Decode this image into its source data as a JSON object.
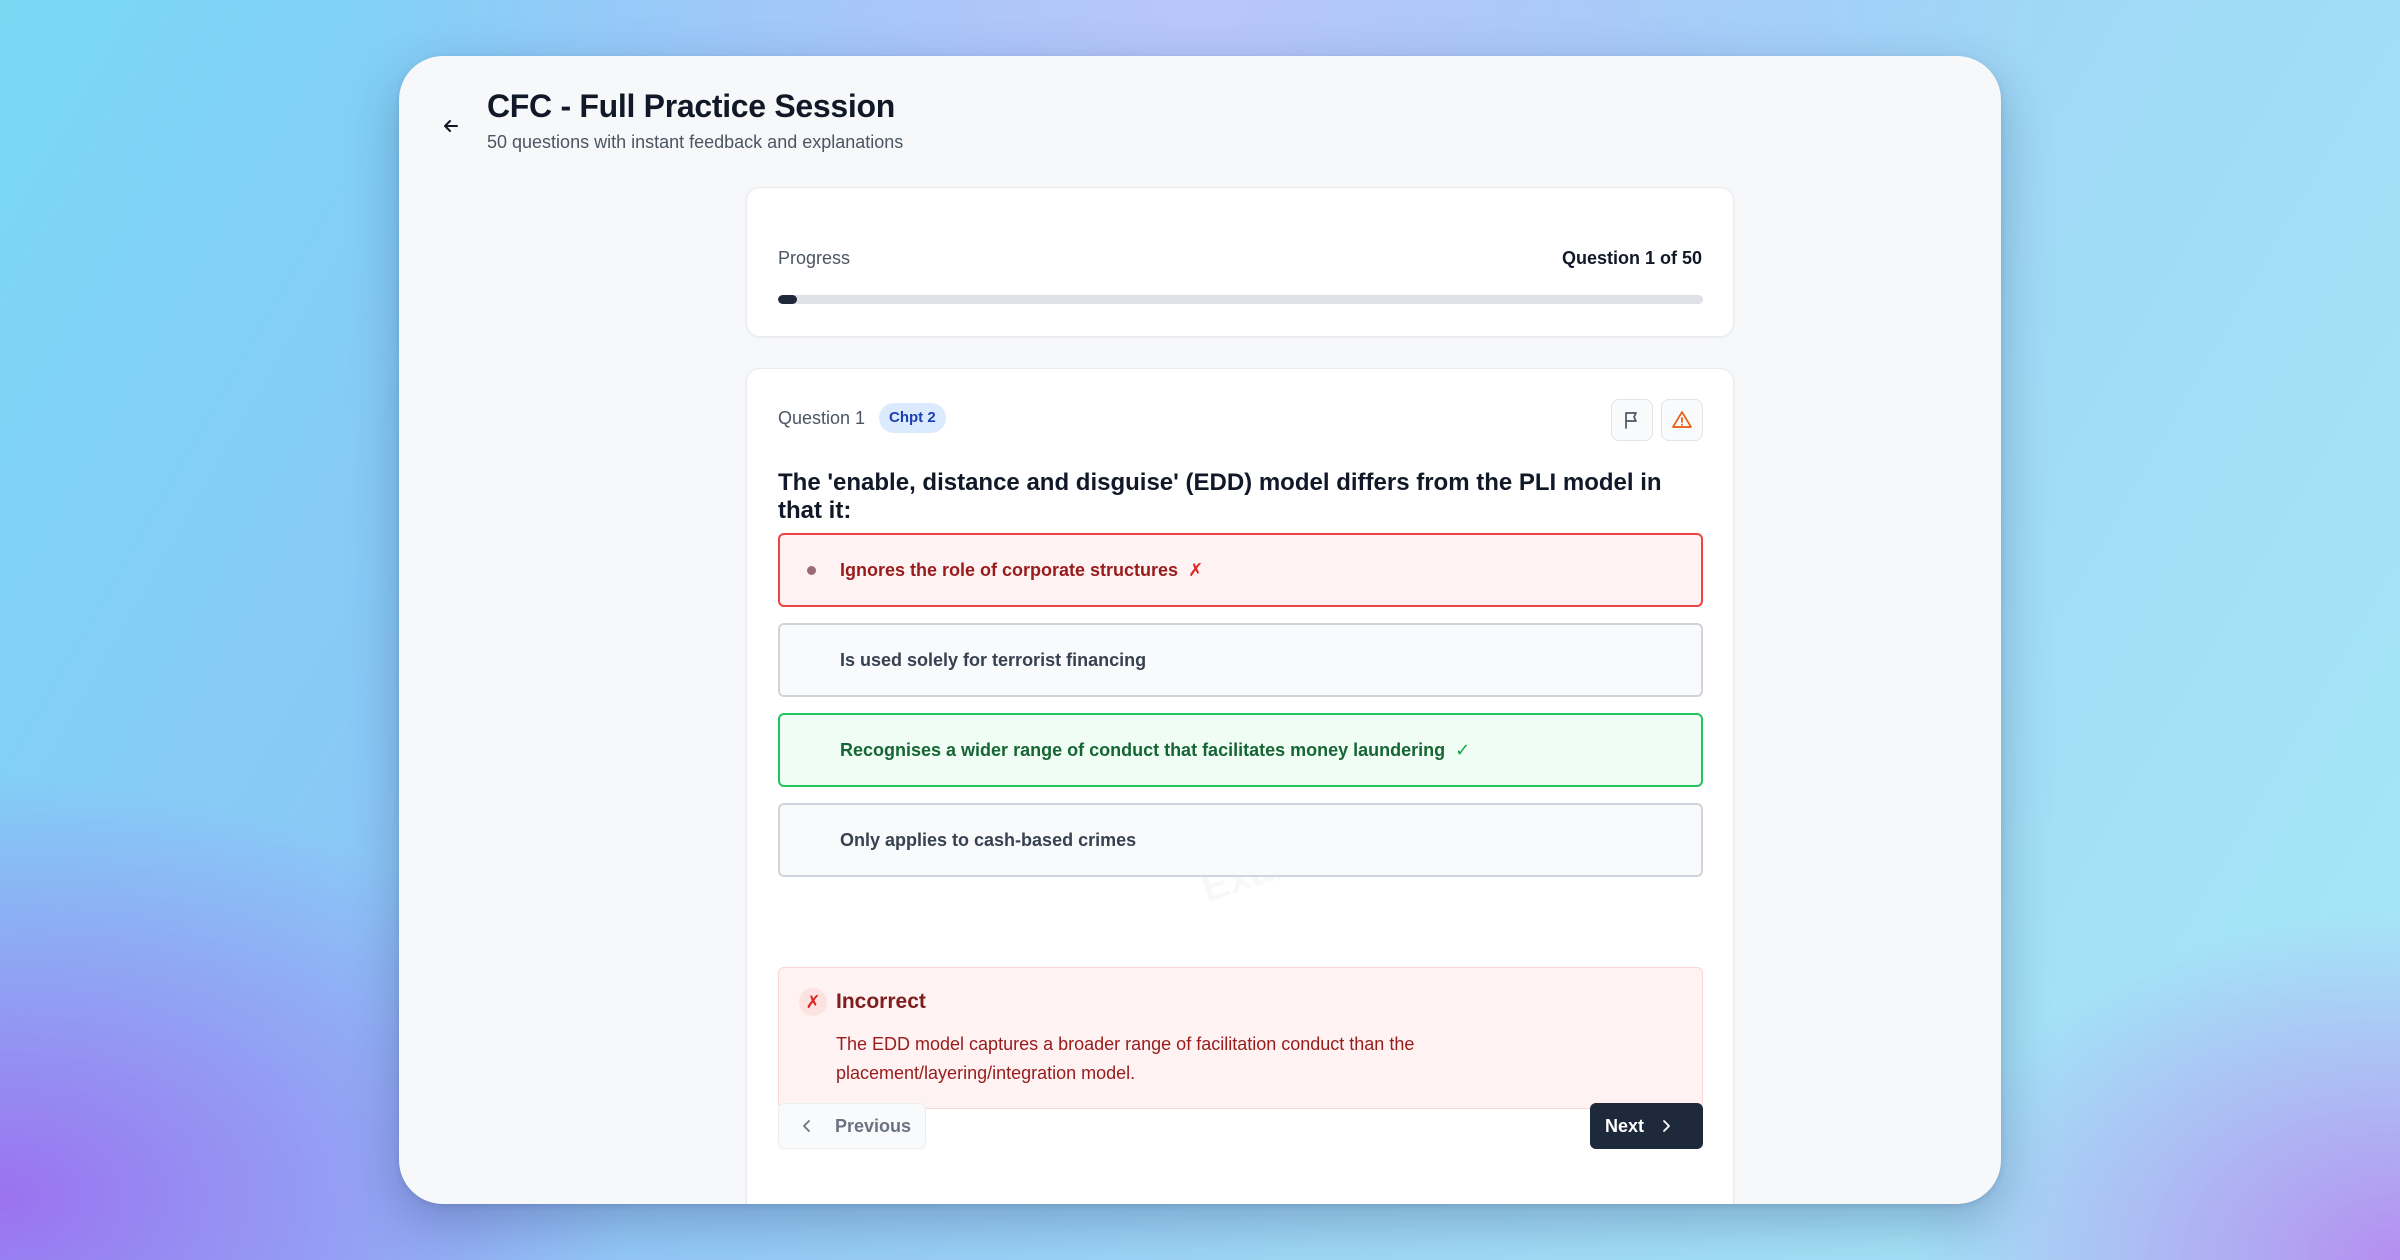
{
  "header": {
    "title": "CFC - Full Practice Session",
    "subtitle": "50 questions with instant feedback and explanations",
    "back_icon": "arrow-left-icon"
  },
  "progress": {
    "label": "Progress",
    "count_text": "Question 1 of 50",
    "current": 1,
    "total": 50
  },
  "question": {
    "number_label": "Question 1",
    "chapter_badge": "Chpt 2",
    "text": "The 'enable, distance and disguise' (EDD) model differs from the PLI model in that it:",
    "flag_icon": "flag-icon",
    "report_icon": "warning-triangle-icon",
    "options": [
      {
        "text": "Ignores the role of corporate structures",
        "state": "wrong",
        "mark": "✗"
      },
      {
        "text": "Is used solely for terrorist financing",
        "state": "neutral",
        "mark": ""
      },
      {
        "text": "Recognises a wider range of conduct that facilitates money laundering",
        "state": "correct",
        "mark": "✓"
      },
      {
        "text": "Only applies to cash-based crimes",
        "state": "neutral",
        "mark": ""
      }
    ]
  },
  "feedback": {
    "icon": "✗",
    "title": "Incorrect",
    "text": "The EDD model captures a broader range of facilitation conduct than the placement/layering/integration model."
  },
  "watermark": "ExamPrep.ae",
  "nav": {
    "previous_label": "Previous",
    "next_label": "Next"
  },
  "colors": {
    "wrong": "#ef4444",
    "correct": "#22c55e",
    "primary": "#1e293b",
    "badge_bg": "#dbeafe"
  }
}
